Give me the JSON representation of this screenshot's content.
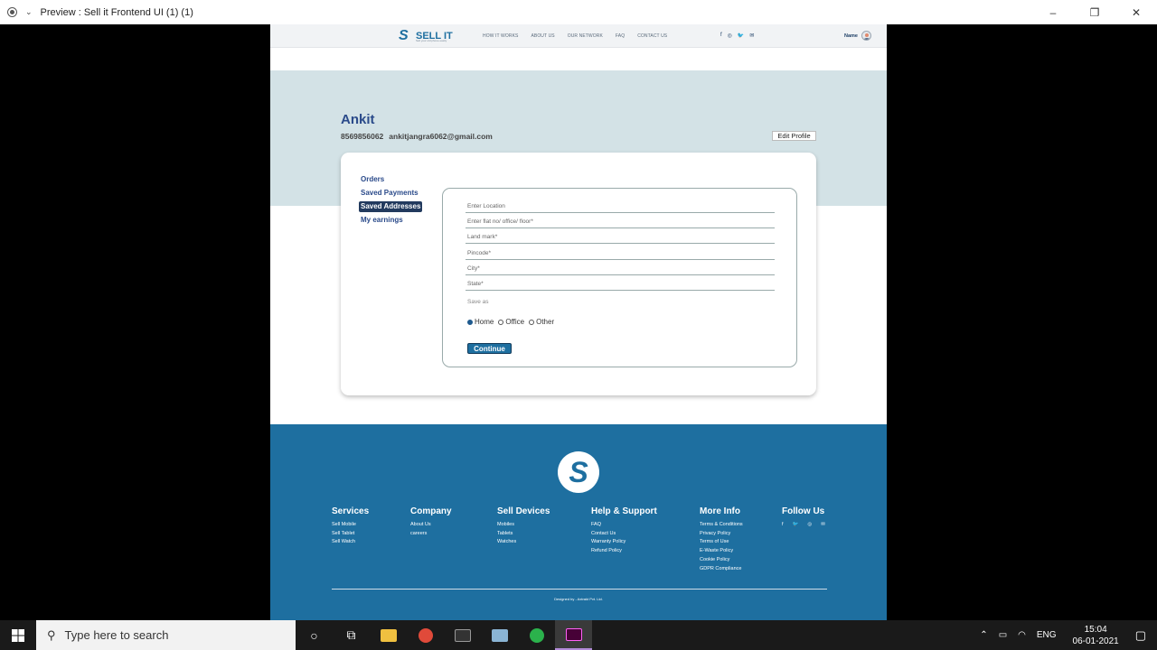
{
  "window": {
    "title": "Preview : Sell it Frontend UI (1) (1)",
    "minimize": "–",
    "maximize": "❐",
    "close": "✕"
  },
  "nav": {
    "brand": "SELL IT",
    "tagline": "Sell your old phone easily",
    "links": [
      "HOW IT WORKS",
      "ABOUT US",
      "OUR NETWORK",
      "FAQ",
      "CONTACT US"
    ],
    "social": [
      "f",
      "◎",
      "🐦",
      "✉"
    ],
    "user_label": "Name"
  },
  "profile": {
    "name": "Ankit",
    "phone": "8569856062",
    "email": "ankitjangra6062@gmail.com",
    "edit_label": "Edit Profile"
  },
  "menu": {
    "orders": "Orders",
    "payments": "Saved Payments",
    "addresses": "Saved Addresses",
    "earnings": "My earnings"
  },
  "form": {
    "location": "Enter Location",
    "flat": "Enter flat no/ office/ floor*",
    "landmark": "Land mark*",
    "pincode": "Pincode*",
    "city": "City*",
    "state": "State*",
    "save_as": "Save as",
    "options": [
      "Home",
      "Office",
      "Other"
    ],
    "selected": "Home",
    "continue_label": "Continue"
  },
  "footer": {
    "services": {
      "title": "Services",
      "items": [
        "Sell Mobile",
        "Sell Tablet",
        "Sell Watch"
      ]
    },
    "company": {
      "title": "Company",
      "items": [
        "About Us",
        "careers"
      ]
    },
    "devices": {
      "title": "Sell Devices",
      "items": [
        "Mobiles",
        "Tablets",
        "Watches"
      ]
    },
    "help": {
      "title": "Help & Support",
      "items": [
        "FAQ",
        "Contact Us",
        "Warranty Policy",
        "Refund Policy"
      ]
    },
    "more": {
      "title": "More Info",
      "items": [
        "Terms & Conditions",
        "Privacy Policy",
        "Terms of Use",
        "E-Waste Policy",
        "Cookie Policy",
        "GDPR Compliance"
      ]
    },
    "follow": {
      "title": "Follow Us"
    },
    "credit": "Designed by - Axtrakt Pvt. Ltd."
  },
  "taskbar": {
    "search_placeholder": "Type here to search",
    "lang": "ENG",
    "time": "15:04",
    "date": "06-01-2021"
  }
}
